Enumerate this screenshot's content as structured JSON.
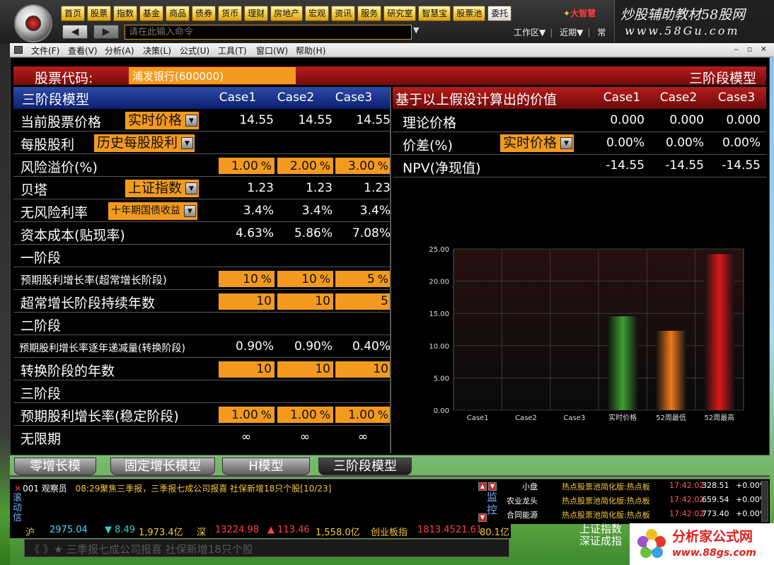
{
  "topbar": {
    "nav": [
      "首页",
      "股票",
      "指数",
      "基金",
      "商品",
      "债券",
      "货币",
      "理财",
      "房地产",
      "宏观",
      "资讯",
      "服务",
      "研究室",
      "智慧宝",
      "股票池",
      "委托"
    ],
    "active_nav": "委托",
    "brand_mark": "大智慧",
    "command_placeholder": "请在此输入命令",
    "back_icon": "back-arrow-icon",
    "forward_icon": "forward-arrow-icon",
    "work_area": "工作区▼",
    "recent": "近期▼",
    "common": "常"
  },
  "watermark_top": {
    "line1": "炒股辅助教材58股网",
    "line2": "www.58Gu.com"
  },
  "menubar": {
    "items": [
      "文件(F)",
      "查看(V)",
      "分析(A)",
      "决策(L)",
      "公式(U)",
      "工具(T)",
      "窗口(W)",
      "帮助(H)"
    ]
  },
  "stock": {
    "label": "股票代码:",
    "value": "浦发银行(600000)",
    "model_title": "三阶段模型"
  },
  "left_table": {
    "title": "三阶段模型",
    "cases": [
      "Case1",
      "Case2",
      "Case3"
    ],
    "rows": {
      "price": {
        "label": "当前股票价格",
        "combo": "实时价格",
        "values": [
          "14.55",
          "14.55",
          "14.55"
        ]
      },
      "dividend": {
        "label": "每股股利",
        "combo": "历史每股股利"
      },
      "risk_premium": {
        "label": "风险溢价(%)",
        "inputs": [
          "1.00",
          "2.00",
          "3.00"
        ],
        "unit": "%"
      },
      "beta": {
        "label": "贝塔",
        "combo": "上证指数",
        "values": [
          "1.23",
          "1.23",
          "1.23"
        ]
      },
      "riskfree": {
        "label": "无风险利率",
        "combo": "十年期国债收益",
        "values": [
          "3.4%",
          "3.4%",
          "3.4%"
        ]
      },
      "cost": {
        "label": "资本成本(贴现率)",
        "values": [
          "4.63%",
          "5.86%",
          "7.08%"
        ]
      },
      "stage1": {
        "label": "一阶段"
      },
      "growth1": {
        "label": "预期股利增长率(超常增长阶段)",
        "inputs": [
          "10",
          "10",
          "5"
        ],
        "unit": "%"
      },
      "years1": {
        "label": "超常增长阶段持续年数",
        "inputs": [
          "10",
          "10",
          "5"
        ]
      },
      "stage2": {
        "label": "二阶段"
      },
      "decline": {
        "label": "预期股利增长率逐年递减量(转换阶段)",
        "values": [
          "0.90%",
          "0.90%",
          "0.40%"
        ]
      },
      "years2": {
        "label": "转换阶段的年数",
        "inputs": [
          "10",
          "10",
          "10"
        ]
      },
      "stage3": {
        "label": "三阶段"
      },
      "growth3": {
        "label": "预期股利增长率(稳定阶段)",
        "inputs": [
          "1.00",
          "1.00",
          "1.00"
        ],
        "unit": "%"
      },
      "infinite": {
        "label": "无限期",
        "values": [
          "∞",
          "∞",
          "∞"
        ]
      }
    }
  },
  "right_table": {
    "title": "基于以上假设计算出的价值",
    "cases": [
      "Case1",
      "Case2",
      "Case3"
    ],
    "rows": {
      "theory": {
        "label": "理论价格",
        "values": [
          "0.000",
          "0.000",
          "0.000"
        ]
      },
      "diff": {
        "label": "价差(%)",
        "combo": "实时价格",
        "values": [
          "0.00%",
          "0.00%",
          "0.00%"
        ]
      },
      "npv": {
        "label": "NPV(净现值)",
        "values": [
          "-14.55",
          "-14.55",
          "-14.55"
        ]
      }
    }
  },
  "chart_data": {
    "type": "bar",
    "categories": [
      "Case1",
      "Case2",
      "Case3",
      "实时价格",
      "52周最低",
      "52周最高"
    ],
    "values": [
      0,
      0,
      0,
      14.55,
      12.3,
      24.2
    ],
    "bar_colors": [
      "#3a8a2a",
      "#3a8a2a",
      "#3a8a2a",
      "#3ea02e",
      "#f07a1a",
      "#e01818"
    ],
    "ylim": [
      0,
      25
    ],
    "yticks": [
      "0.00",
      "5.00",
      "10.00",
      "15.00",
      "20.00",
      "25.00"
    ],
    "title": "",
    "xlabel": "",
    "ylabel": "",
    "grid": true
  },
  "tabs": [
    "零增长模",
    "固定增长模型",
    "H模型",
    "三阶段模型"
  ],
  "active_tab": "三阶段模型",
  "news": {
    "code": "001",
    "who": "观察员",
    "text": "08:29聚焦三季报，三季报七成公司报喜 社保新增18只个股[10/23]",
    "vertical": "滚动信",
    "vertical_right": "监控"
  },
  "hot": [
    {
      "name": "小盘",
      "source": "热点股票池简化版:热点板",
      "time": "17:42:02",
      "value": "328.51",
      "change": "+0.00%"
    },
    {
      "name": "农业龙头",
      "source": "热点股票池简化版:热点板",
      "time": "17:42:02",
      "value": "659.54",
      "change": "+0.00%"
    },
    {
      "name": "合同能源",
      "source": "热点股票池简化版:热点板",
      "time": "17:42:02",
      "value": "773.40",
      "change": "+0.00%"
    }
  ],
  "ticker": {
    "sh_label": "沪",
    "sh_value": "2975.04",
    "sh_change": "▼ 8.49",
    "sh_amount": "1,973.4亿",
    "sz_label": "深",
    "sz_value": "13224.98",
    "sz_change": "▲ 113.46",
    "sz_amount": "1,558.0亿",
    "cy_label": "创业板指",
    "cy_value": "1813.45",
    "cy_change": "21.61",
    "cy_amount": "80.1亿"
  },
  "scroll_news": "《 》★ 三季报七成公司报喜 社保新增18只个股",
  "index_right": {
    "line1": "上证指数",
    "line2": "深证成指"
  },
  "watermark_bot": {
    "line1": "分析家公式网",
    "line2": "www.88gs.com"
  }
}
